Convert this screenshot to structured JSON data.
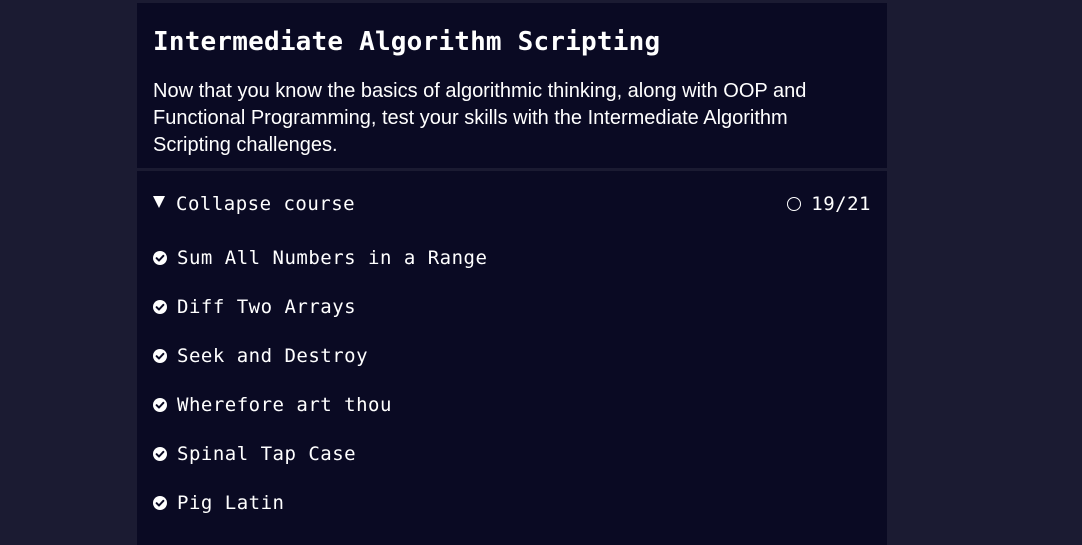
{
  "course": {
    "title": "Intermediate Algorithm Scripting",
    "description": "Now that you know the basics of algorithmic thinking, along with OOP and Functional Programming, test your skills with the Intermediate Algorithm Scripting challenges."
  },
  "toggle": {
    "label": "Collapse course",
    "icon": "caret-down-icon",
    "progress_text": "19/21",
    "progress_icon": "circle-outline-icon"
  },
  "challenges": [
    {
      "label": "Sum All Numbers in a Range",
      "completed": true,
      "icon": "check-circle-icon"
    },
    {
      "label": "Diff Two Arrays",
      "completed": true,
      "icon": "check-circle-icon"
    },
    {
      "label": "Seek and Destroy",
      "completed": true,
      "icon": "check-circle-icon"
    },
    {
      "label": "Wherefore art thou",
      "completed": true,
      "icon": "check-circle-icon"
    },
    {
      "label": "Spinal Tap Case",
      "completed": true,
      "icon": "check-circle-icon"
    },
    {
      "label": "Pig Latin",
      "completed": true,
      "icon": "check-circle-icon"
    }
  ],
  "colors": {
    "page_background": "#1b1b32",
    "panel_background": "#0a0a23",
    "text": "#ffffff"
  }
}
